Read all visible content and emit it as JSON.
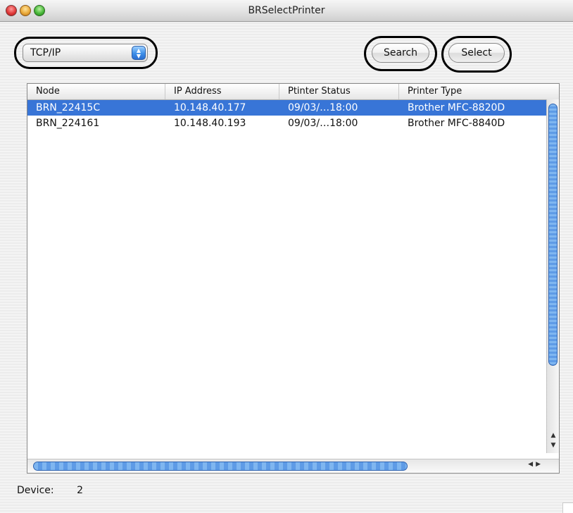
{
  "window": {
    "title": "BRSelectPrinter"
  },
  "toolbar": {
    "connection_type": "TCP/IP",
    "search_label": "Search",
    "select_label": "Select"
  },
  "table": {
    "columns": [
      "Node",
      "IP Address",
      "Ptinter Status",
      "Printer Type"
    ],
    "rows": [
      {
        "node": "BRN_22415C",
        "ip": "10.148.40.177",
        "status": "09/03/…18:00",
        "type": "Brother MFC-8820D",
        "selected": true
      },
      {
        "node": "BRN_224161",
        "ip": "10.148.40.193",
        "status": "09/03/…18:00",
        "type": "Brother MFC-8840D",
        "selected": false
      }
    ]
  },
  "footer": {
    "device_label": "Device:",
    "device_count": "2"
  },
  "icons": {
    "close": "close-icon",
    "minimize": "minimize-icon",
    "zoom": "zoom-icon",
    "popup_arrows": "updown-arrows-icon"
  },
  "colors": {
    "selection": "#3875d7",
    "accent": "#3d8fe8"
  }
}
